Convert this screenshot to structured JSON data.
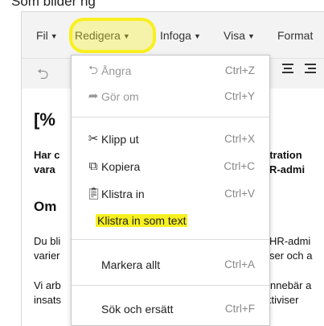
{
  "caption": "Som bilder ng",
  "menubar": {
    "items": [
      {
        "label": "Fil"
      },
      {
        "label": "Redigera"
      },
      {
        "label": "Infoga"
      },
      {
        "label": "Visa"
      },
      {
        "label": "Format"
      }
    ]
  },
  "doc": {
    "heading": "[%",
    "line1": "Har c",
    "line1_right": "stration",
    "line2": "vara",
    "line2_right": "R-admi",
    "section": "Om",
    "p1a": "Du bli",
    "p1a_right": "HR-admi",
    "p1b": "varier",
    "p1b_right": "ser och a",
    "p2a": "Vi arb",
    "p2a_right": "nnebär a",
    "p2b": "insats",
    "p2b_right": "ktiviser"
  },
  "edit_menu": {
    "undo": {
      "label": "Ångra",
      "shortcut": "Ctrl+Z"
    },
    "redo": {
      "label": "Gör om",
      "shortcut": "Ctrl+Y"
    },
    "cut": {
      "label": "Klipp ut",
      "shortcut": "Ctrl+X"
    },
    "copy": {
      "label": "Kopiera",
      "shortcut": "Ctrl+C"
    },
    "paste": {
      "label": "Klistra in",
      "shortcut": "Ctrl+V"
    },
    "paste_text": {
      "label": "Klistra in som text"
    },
    "select_all": {
      "label": "Markera allt",
      "shortcut": "Ctrl+A"
    },
    "find_replace": {
      "label": "Sök och ersätt",
      "shortcut": "Ctrl+F"
    }
  },
  "colors": {
    "highlight": "#f7f020",
    "menubar_bg": "#f3f3f3"
  }
}
